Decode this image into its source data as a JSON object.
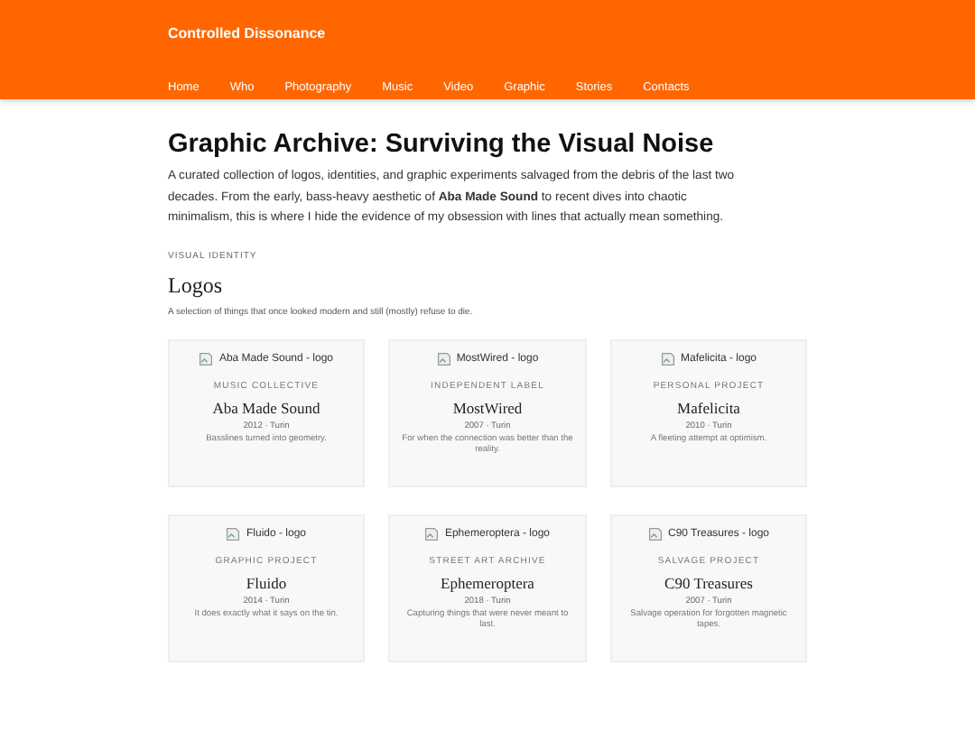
{
  "site_title": "Controlled Dissonance",
  "nav": [
    {
      "label": "Home"
    },
    {
      "label": "Who"
    },
    {
      "label": "Photography"
    },
    {
      "label": "Music"
    },
    {
      "label": "Video"
    },
    {
      "label": "Graphic"
    },
    {
      "label": "Stories"
    },
    {
      "label": "Contacts"
    }
  ],
  "page_title": "Graphic Archive: Surviving the Visual Noise",
  "intro": "A curated collection of logos, identities, and graphic experiments salvaged from the debris of the last two decades. From the early, bass-heavy aesthetic of **Aba Made Sound** to recent dives into chaotic minimalism, this is where I hide the evidence of my obsession with lines that actually mean something.",
  "section": {
    "eyebrow": "VISUAL IDENTITY",
    "heading": "Logos",
    "description": "A selection of things that once looked modern and still (mostly) refuse to die."
  },
  "cards": [
    {
      "image_alt": "Aba Made Sound - logo",
      "category": "MUSIC COLLECTIVE",
      "name": "Aba Made Sound",
      "meta": "2012 · Turin",
      "caption": "Basslines turned into geometry."
    },
    {
      "image_alt": "MostWired - logo",
      "category": "INDEPENDENT LABEL",
      "name": "MostWired",
      "meta": "2007 · Turin",
      "caption": "For when the connection was better than the reality."
    },
    {
      "image_alt": "Mafelicita - logo",
      "category": "PERSONAL PROJECT",
      "name": "Mafelicita",
      "meta": "2010 · Turin",
      "caption": "A fleeting attempt at optimism."
    },
    {
      "image_alt": "Fluido - logo",
      "category": "GRAPHIC PROJECT",
      "name": "Fluido",
      "meta": "2014 · Turin",
      "caption": "It does exactly what it says on the tin."
    },
    {
      "image_alt": "Ephemeroptera - logo",
      "category": "STREET ART ARCHIVE",
      "name": "Ephemeroptera",
      "meta": "2018 · Turin",
      "caption": "Capturing things that were never meant to last."
    },
    {
      "image_alt": "C90 Treasures - logo",
      "category": "SALVAGE PROJECT",
      "name": "C90 Treasures",
      "meta": "2007 · Turin",
      "caption": "Salvage operation for forgotten magnetic tapes."
    }
  ]
}
